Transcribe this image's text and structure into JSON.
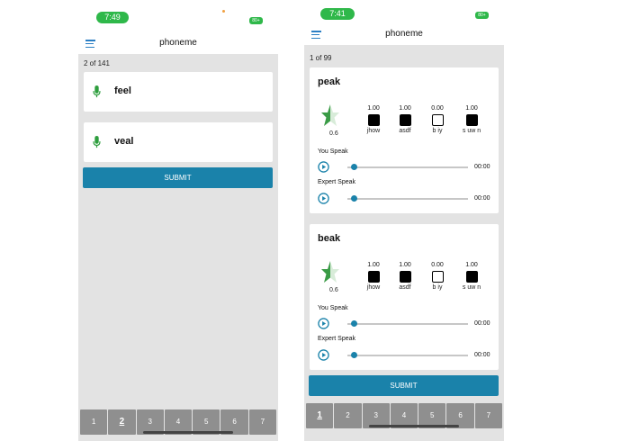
{
  "left": {
    "status": {
      "time": "7:49",
      "battery": "80+"
    },
    "header": {
      "title": "phoneme"
    },
    "counter": "2 of 141",
    "words": [
      {
        "text": "feel"
      },
      {
        "text": "veal"
      }
    ],
    "submit_label": "SUBMIT",
    "pages": [
      "1",
      "2",
      "3",
      "4",
      "5",
      "6",
      "7"
    ],
    "active_page": "2"
  },
  "right": {
    "status": {
      "time": "7:41",
      "battery": "80+"
    },
    "header": {
      "title": "phoneme"
    },
    "counter": "1 of 99",
    "cards": [
      {
        "word": "peak",
        "score": "0.6",
        "phonemes": [
          {
            "value": "1.00",
            "label": "jhow",
            "filled": true
          },
          {
            "value": "1.00",
            "label": "asdf",
            "filled": true
          },
          {
            "value": "0.00",
            "label": "b iy",
            "filled": false
          },
          {
            "value": "1.00",
            "label": "s uw n",
            "filled": true
          }
        ],
        "you_speak_label": "You Speak",
        "you_speak_time": "00:00",
        "expert_speak_label": "Expert Speak",
        "expert_speak_time": "00:00"
      },
      {
        "word": "beak",
        "score": "0.6",
        "phonemes": [
          {
            "value": "1.00",
            "label": "jhow",
            "filled": true
          },
          {
            "value": "1.00",
            "label": "asdf",
            "filled": true
          },
          {
            "value": "0.00",
            "label": "b iy",
            "filled": false
          },
          {
            "value": "1.00",
            "label": "s uw n",
            "filled": true
          }
        ],
        "you_speak_label": "You Speak",
        "you_speak_time": "00:00",
        "expert_speak_label": "Expert Speak",
        "expert_speak_time": "00:00"
      }
    ],
    "submit_label": "SUBMIT",
    "pages": [
      "1",
      "2",
      "3",
      "4",
      "5",
      "6",
      "7"
    ],
    "active_page": "1"
  },
  "colors": {
    "accent": "#1a82aa",
    "status_green": "#2fb84a",
    "menu_blue": "#2b7fc4",
    "mic_green": "#2e9e3e"
  },
  "icons": {
    "menu": "hamburger-icon",
    "mic": "microphone-icon",
    "play": "play-circle-icon",
    "score": "star-icon"
  }
}
